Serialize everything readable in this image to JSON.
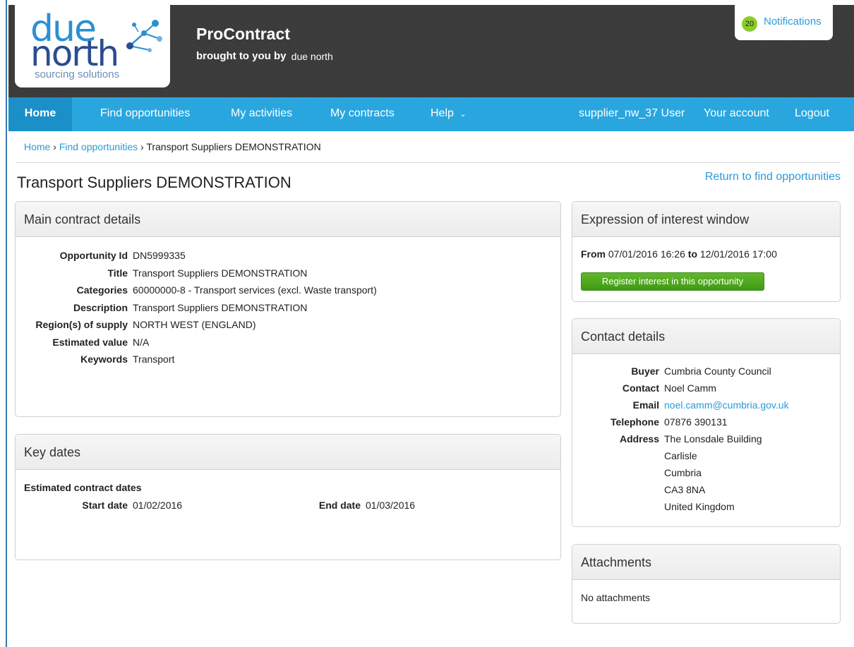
{
  "header": {
    "logo": {
      "due": "due",
      "north": "north",
      "sub": "sourcing solutions"
    },
    "app_title": "ProContract",
    "app_subtitle": "brought to you by",
    "app_subtitle_logo": "due north",
    "notifications": {
      "count": "20",
      "label": "Notifications"
    }
  },
  "nav": {
    "home": "Home",
    "find": "Find opportunities",
    "activities": "My activities",
    "contracts": "My contracts",
    "help": "Help",
    "user": "supplier_nw_37 User",
    "account": "Your account",
    "logout": "Logout"
  },
  "breadcrumb": {
    "home": "Home",
    "sep1": "›",
    "find": "Find opportunities",
    "sep2": "›",
    "current": "Transport Suppliers DEMONSTRATION"
  },
  "page": {
    "title": "Transport Suppliers DEMONSTRATION",
    "return_link": "Return to find opportunities"
  },
  "main_details": {
    "heading": "Main contract details",
    "rows": [
      {
        "key": "Opportunity Id",
        "value": "DN5999335"
      },
      {
        "key": "Title",
        "value": "Transport Suppliers DEMONSTRATION"
      },
      {
        "key": "Categories",
        "value": "60000000-8 - Transport services (excl. Waste transport)"
      },
      {
        "key": "Description",
        "value": "Transport Suppliers DEMONSTRATION"
      },
      {
        "key": "Region(s) of supply",
        "value": "NORTH WEST (ENGLAND)"
      },
      {
        "key": "Estimated value",
        "value": "N/A"
      },
      {
        "key": "Keywords",
        "value": "Transport"
      }
    ]
  },
  "key_dates": {
    "heading": "Key dates",
    "subheading": "Estimated contract dates",
    "start_label": "Start date",
    "start_value": "01/02/2016",
    "end_label": "End date",
    "end_value": "01/03/2016"
  },
  "eoi": {
    "heading": "Expression of interest window",
    "from_label": "From",
    "from_value": "07/01/2016 16:26",
    "to_label": "to",
    "to_value": "12/01/2016 17:00",
    "button": "Register interest in this opportunity"
  },
  "contact": {
    "heading": "Contact details",
    "buyer_label": "Buyer",
    "buyer": "Cumbria County Council",
    "contact_label": "Contact",
    "contact": "Noel Camm",
    "email_label": "Email",
    "email": "noel.camm@cumbria.gov.uk",
    "phone_label": "Telephone",
    "phone": "07876 390131",
    "address_label": "Address",
    "address": [
      "The Lonsdale Building",
      "Carlisle",
      "Cumbria",
      "CA3 8NA",
      "United Kingdom"
    ]
  },
  "attachments": {
    "heading": "Attachments",
    "empty": "No attachments"
  },
  "colors": {
    "nav": "#2aa6df",
    "link": "#2a9bd6",
    "button": "#4ea51c",
    "badge": "#8ccc2a"
  }
}
